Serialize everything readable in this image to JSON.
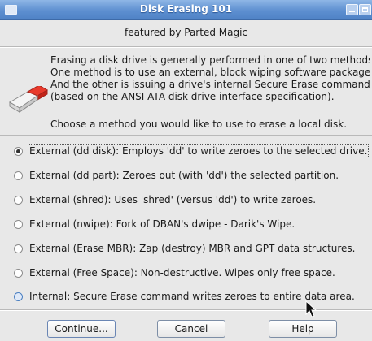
{
  "window": {
    "title": "Disk Erasing 101",
    "icons": {
      "app": "window-icon",
      "minimize": "minimize-icon",
      "maximize": "maximize-icon"
    }
  },
  "header": {
    "featured": "featured by Parted Magic"
  },
  "description": {
    "icon": "eraser-icon",
    "lines": [
      "Erasing a disk drive is generally performed in one of two methods",
      "One method is to use an external, block wiping software package.",
      "And the other is issuing a drive's internal Secure Erase command",
      "(based on the ANSI ATA disk drive interface specification)."
    ],
    "prompt": "Choose a method you would like to use to erase a local disk."
  },
  "options": [
    {
      "label": "External (dd disk): Employs 'dd' to write zeroes to the selected drive.",
      "checked": true
    },
    {
      "label": "External (dd part): Zeroes out (with 'dd') the selected partition.",
      "checked": false
    },
    {
      "label": "External (shred): Uses 'shred' (versus 'dd') to write zeroes.",
      "checked": false
    },
    {
      "label": "External (nwipe): Fork of DBAN's dwipe - Darik's Wipe.",
      "checked": false
    },
    {
      "label": "External (Erase MBR): Zap (destroy) MBR and GPT data structures.",
      "checked": false
    },
    {
      "label": "External (Free Space): Non-destructive. Wipes only free space.",
      "checked": false
    },
    {
      "label": "Internal: Secure Erase command writes zeroes to entire data area.",
      "checked": false
    }
  ],
  "buttons": {
    "continue": "Continue...",
    "cancel": "Cancel",
    "help": "Help"
  },
  "cursor": {
    "icon": "mouse-pointer-icon"
  }
}
